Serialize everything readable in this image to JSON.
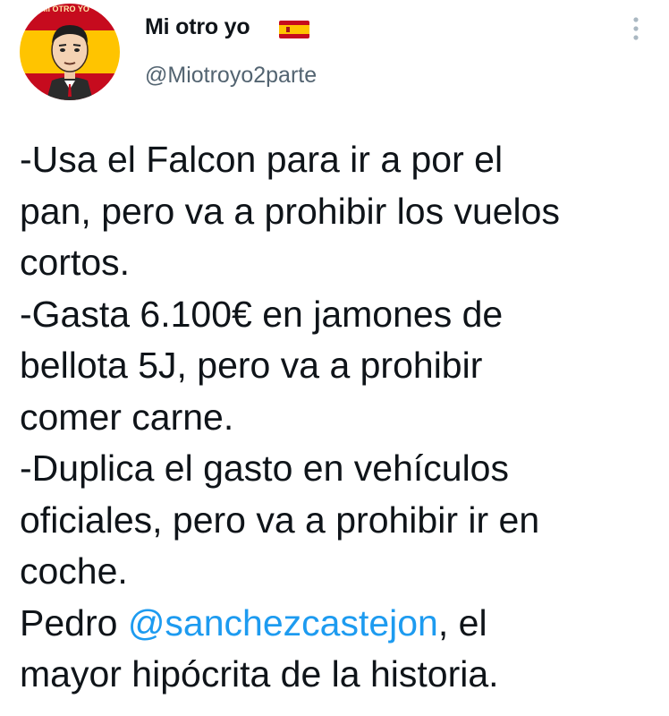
{
  "author": {
    "display_name": "Mi otro yo",
    "handle": "@Miotroyo2parte",
    "avatar_banner_text": "MI OTRO YO",
    "flag_icon": "spain-flag-icon"
  },
  "menu_icon": "vertical-ellipsis-icon",
  "tweet": {
    "lines": [
      "-Usa el Falcon para ir a por el",
      "pan, pero va a prohibir los vuelos",
      "cortos.",
      "-Gasta 6.100€ en jamones de",
      "bellota 5J, pero va a prohibir",
      "comer carne.",
      "-Duplica el gasto en vehículos",
      "oficiales, pero va a prohibir ir en",
      "coche."
    ],
    "last_line_1_before": "Pedro ",
    "mention": "@sanchezcastejon",
    "last_line_1_after": ", el",
    "last_line_2": "mayor hipócrita de la historia."
  },
  "colors": {
    "text": "#0f1419",
    "secondary": "#536471",
    "link": "#1d9bf0",
    "flag_red": "#c60b1e",
    "flag_yellow": "#ffc400"
  }
}
